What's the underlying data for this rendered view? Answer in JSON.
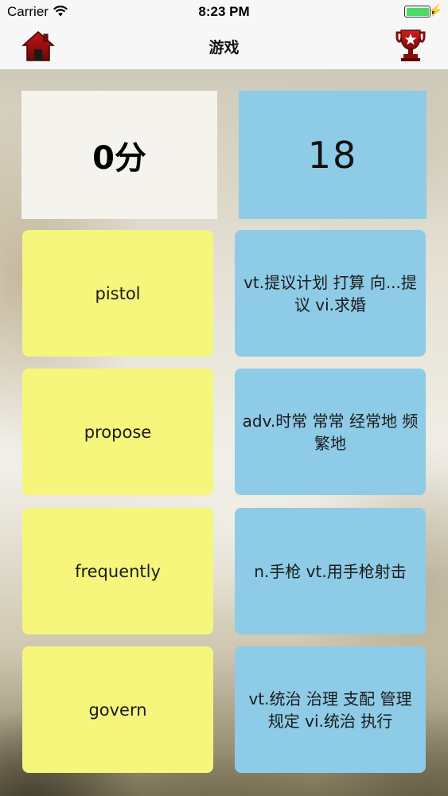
{
  "status_bar": {
    "carrier": "Carrier",
    "time": "8:23 PM",
    "battery_icon": "battery-full-icon",
    "wifi_icon": "wifi-icon"
  },
  "nav": {
    "title": "游戏",
    "home_icon": "home-icon",
    "trophy_icon": "trophy-icon"
  },
  "score": {
    "text": "0分"
  },
  "timer": {
    "text": "18"
  },
  "words": [
    {
      "label": "pistol"
    },
    {
      "label": "propose"
    },
    {
      "label": "frequently"
    },
    {
      "label": "govern"
    }
  ],
  "definitions": [
    {
      "text": "vt.提议计划 打算 向...提议 vi.求婚"
    },
    {
      "text": "adv.时常 常常 经常地 频繁地"
    },
    {
      "text": "n.手枪 vt.用手枪射击"
    },
    {
      "text": "vt.统治 治理 支配 管理 规定 vi.统治 执行"
    }
  ],
  "colors": {
    "word_tile": "#f6f57c",
    "definition_tile": "#8ecbe6",
    "score_tile": "#f5f3ee",
    "home_icon": "#8b0b0b",
    "trophy_icon": "#a30f0f"
  }
}
